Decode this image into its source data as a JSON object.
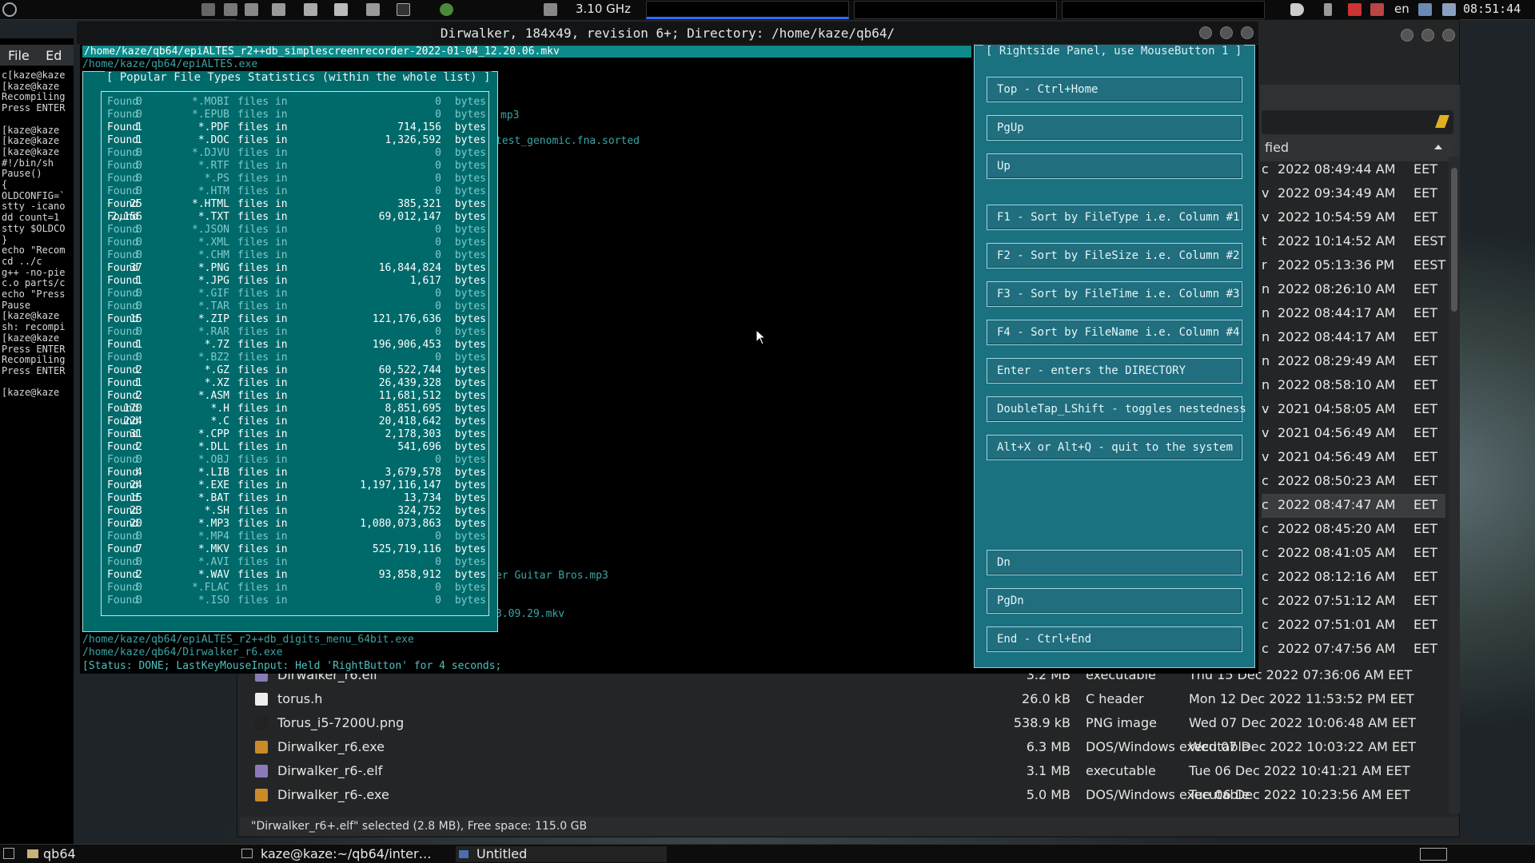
{
  "topbar": {
    "cpu_freq": "3.10 GHz",
    "lang": "en",
    "clock": "08:51:44"
  },
  "left_terminal": {
    "menu": [
      "File",
      "Ed"
    ],
    "lines": [
      "c[kaze@kaze",
      "[kaze@kaze",
      "Recompiling",
      "Press ENTER",
      "",
      "[kaze@kaze",
      "[kaze@kaze",
      "[kaze@kaze",
      "#!/bin/sh",
      "Pause()",
      "{",
      "OLDCONFIG=`",
      "stty -icano",
      "dd count=1",
      "stty $OLDCO",
      "}",
      "echo \"Recom",
      "cd ../c",
      "g++ -no-pie",
      "c.o parts/c",
      "echo \"Press",
      "Pause",
      "[kaze@kaze",
      "sh: recompi",
      "[kaze@kaze",
      "Press ENTER",
      "Recompiling",
      "Press ENTER",
      "",
      "[kaze@kaze"
    ]
  },
  "dirwalker": {
    "title": "Dirwalker, 184x49, revision 6+; Directory: /home/kaze/qb64/",
    "path_selected": "/home/kaze/qb64/epiALTES_r2++db_simplescreenrecorder-2022-01-04_12.20.06.mkv",
    "line2": "/home/kaze/qb64/epiALTES.exe",
    "frag_mp3": "mp3",
    "frag_genomic": "test_genomic.fna.sorted",
    "frag_guitar": "er Guitar Bros.mp3",
    "frag_mkv": "3.09.29.mkv",
    "line_digits": "/home/kaze/qb64/epiALTES_r2++db_digits_menu_64bit.exe",
    "line_r6": "/home/kaze/qb64/Dirwalker_r6.exe",
    "status": "[Status: DONE; LastKeyMouseInput: Held 'RightButton' for 4 seconds;",
    "row_prefix": "/h"
  },
  "stats": {
    "title": "[ Popular File Types Statistics (within the whole list) ]",
    "word_found": "Found",
    "word_files_in": "files in",
    "word_bytes": "bytes",
    "rows": [
      {
        "count": "0",
        "ext": "*.MOBI",
        "size": "0"
      },
      {
        "count": "0",
        "ext": "*.EPUB",
        "size": "0"
      },
      {
        "count": "1",
        "ext": "*.PDF",
        "size": "714,156"
      },
      {
        "count": "1",
        "ext": "*.DOC",
        "size": "1,326,592"
      },
      {
        "count": "0",
        "ext": "*.DJVU",
        "size": "0"
      },
      {
        "count": "0",
        "ext": "*.RTF",
        "size": "0"
      },
      {
        "count": "0",
        "ext": "*.PS",
        "size": "0"
      },
      {
        "count": "0",
        "ext": "*.HTM",
        "size": "0"
      },
      {
        "count": "25",
        "ext": "*.HTML",
        "size": "385,321"
      },
      {
        "count": "2,156",
        "ext": "*.TXT",
        "size": "69,012,147"
      },
      {
        "count": "0",
        "ext": "*.JSON",
        "size": "0"
      },
      {
        "count": "0",
        "ext": "*.XML",
        "size": "0"
      },
      {
        "count": "0",
        "ext": "*.CHM",
        "size": "0"
      },
      {
        "count": "37",
        "ext": "*.PNG",
        "size": "16,844,824"
      },
      {
        "count": "1",
        "ext": "*.JPG",
        "size": "1,617"
      },
      {
        "count": "0",
        "ext": "*.GIF",
        "size": "0"
      },
      {
        "count": "0",
        "ext": "*.TAR",
        "size": "0"
      },
      {
        "count": "15",
        "ext": "*.ZIP",
        "size": "121,176,636"
      },
      {
        "count": "0",
        "ext": "*.RAR",
        "size": "0"
      },
      {
        "count": "1",
        "ext": "*.7Z",
        "size": "196,906,453"
      },
      {
        "count": "0",
        "ext": "*.BZ2",
        "size": "0"
      },
      {
        "count": "2",
        "ext": "*.GZ",
        "size": "60,522,744"
      },
      {
        "count": "1",
        "ext": "*.XZ",
        "size": "26,439,328"
      },
      {
        "count": "2",
        "ext": "*.ASM",
        "size": "11,681,512"
      },
      {
        "count": "170",
        "ext": "*.H",
        "size": "8,851,695"
      },
      {
        "count": "224",
        "ext": "*.C",
        "size": "20,418,642"
      },
      {
        "count": "31",
        "ext": "*.CPP",
        "size": "2,178,303"
      },
      {
        "count": "2",
        "ext": "*.DLL",
        "size": "541,696"
      },
      {
        "count": "0",
        "ext": "*.OBJ",
        "size": "0"
      },
      {
        "count": "4",
        "ext": "*.LIB",
        "size": "3,679,578"
      },
      {
        "count": "24",
        "ext": "*.EXE",
        "size": "1,197,116,147"
      },
      {
        "count": "15",
        "ext": "*.BAT",
        "size": "13,734"
      },
      {
        "count": "23",
        "ext": "*.SH",
        "size": "324,752"
      },
      {
        "count": "20",
        "ext": "*.MP3",
        "size": "1,080,073,863"
      },
      {
        "count": "0",
        "ext": "*.MP4",
        "size": "0"
      },
      {
        "count": "7",
        "ext": "*.MKV",
        "size": "525,719,116"
      },
      {
        "count": "0",
        "ext": "*.AVI",
        "size": "0"
      },
      {
        "count": "2",
        "ext": "*.WAV",
        "size": "93,858,912"
      },
      {
        "count": "0",
        "ext": "*.FLAC",
        "size": "0"
      },
      {
        "count": "0",
        "ext": "*.ISO",
        "size": "0"
      }
    ]
  },
  "right_panel": {
    "title": "[ Rightside Panel, use MouseButton 1 ]",
    "buttons": [
      "Top - Ctrl+Home",
      "PgUp",
      "Up",
      "F1 - Sort by FileType i.e. Column #1",
      "F2 - Sort by FileSize i.e. Column #2",
      "F3 - Sort by FileTime i.e. Column #3",
      "F4 - Sort by FileName i.e. Column #4",
      "Enter - enters the DIRECTORY",
      "DoubleTap_LShift - toggles nestedness",
      "Alt+X or Alt+Q - quit to the system",
      "Dn",
      "PgDn",
      "End - Ctrl+End"
    ]
  },
  "file_manager": {
    "col_modified": "fied",
    "rows": [
      {
        "p": "c",
        "d": "2022 08:49:44 AM",
        "tz": "EET"
      },
      {
        "p": "v",
        "d": "2022 09:34:49 AM",
        "tz": "EET"
      },
      {
        "p": "v",
        "d": "2022 10:54:59 AM",
        "tz": "EET"
      },
      {
        "p": "t",
        "d": "2022 10:14:52 AM",
        "tz": "EEST"
      },
      {
        "p": "r",
        "d": "2022 05:13:36 PM",
        "tz": "EEST"
      },
      {
        "p": "n",
        "d": "2022 08:26:10 AM",
        "tz": "EET"
      },
      {
        "p": "n",
        "d": "2022 08:44:17 AM",
        "tz": "EET"
      },
      {
        "p": "n",
        "d": "2022 08:44:17 AM",
        "tz": "EET"
      },
      {
        "p": "n",
        "d": "2022 08:29:49 AM",
        "tz": "EET"
      },
      {
        "p": "n",
        "d": "2022 08:58:10 AM",
        "tz": "EET"
      },
      {
        "p": "v",
        "d": "2021 04:58:05 AM",
        "tz": "EET"
      },
      {
        "p": "v",
        "d": "2021 04:56:49 AM",
        "tz": "EET"
      },
      {
        "p": "v",
        "d": "2021 04:56:49 AM",
        "tz": "EET"
      },
      {
        "p": "c",
        "d": "2022 08:50:23 AM",
        "tz": "EET"
      },
      {
        "p": "c",
        "d": "2022 08:47:47 AM",
        "tz": "EET"
      },
      {
        "p": "c",
        "d": "2022 08:45:20 AM",
        "tz": "EET"
      },
      {
        "p": "c",
        "d": "2022 08:41:05 AM",
        "tz": "EET"
      },
      {
        "p": "c",
        "d": "2022 08:12:16 AM",
        "tz": "EET"
      },
      {
        "p": "c",
        "d": "2022 07:51:12 AM",
        "tz": "EET"
      },
      {
        "p": "c",
        "d": "2022 07:51:01 AM",
        "tz": "EET"
      },
      {
        "p": "c",
        "d": "2022 07:47:56 AM",
        "tz": "EET"
      }
    ],
    "bottom_rows": [
      {
        "name": "Dirwalker_r6.elf",
        "size": "3.2 MB",
        "type": "executable",
        "date": "Thu 15 Dec 2022 07:36:06 AM EET"
      },
      {
        "name": "torus.h",
        "size": "26.0 kB",
        "type": "C header",
        "date": "Mon 12 Dec 2022 11:53:52 PM EET"
      },
      {
        "name": "Torus_i5-7200U.png",
        "size": "538.9 kB",
        "type": "PNG image",
        "date": "Wed 07 Dec 2022 10:06:48 AM EET"
      },
      {
        "name": "Dirwalker_r6.exe",
        "size": "6.3 MB",
        "type": "DOS/Windows executable",
        "date": "Wed 07 Dec 2022 10:03:22 AM EET"
      },
      {
        "name": "Dirwalker_r6-.elf",
        "size": "3.1 MB",
        "type": "executable",
        "date": "Tue 06 Dec 2022 10:41:21 AM EET"
      },
      {
        "name": "Dirwalker_r6-.exe",
        "size": "5.0 MB",
        "type": "DOS/Windows executable",
        "date": "Tue 06 Dec 2022 10:23:56 AM EET"
      }
    ],
    "status": "\"Dirwalker_r6+.elf\" selected (2.8 MB), Free space: 115.0 GB"
  },
  "taskbar": {
    "item1": "qb64",
    "item2": "kaze@kaze:~/qb64/inter…",
    "item3": "Untitled"
  }
}
